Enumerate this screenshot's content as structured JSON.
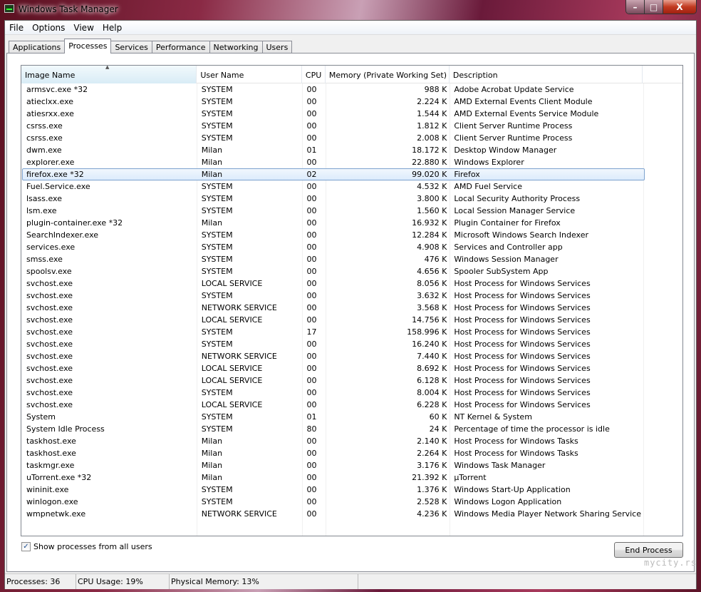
{
  "window": {
    "title": "Windows Task Manager",
    "minimize": "–",
    "maximize": "□",
    "close": "X"
  },
  "menu": [
    "File",
    "Options",
    "View",
    "Help"
  ],
  "tabs": [
    "Applications",
    "Processes",
    "Services",
    "Performance",
    "Networking",
    "Users"
  ],
  "active_tab": "Processes",
  "columns": [
    "Image Name",
    "User Name",
    "CPU",
    "Memory (Private Working Set)",
    "Description"
  ],
  "sort_indicator": "▲",
  "selected_row": 7,
  "processes": [
    [
      "armsvc.exe *32",
      "SYSTEM",
      "00",
      "988 K",
      "Adobe Acrobat Update Service"
    ],
    [
      "atieclxx.exe",
      "SYSTEM",
      "00",
      "2.224 K",
      "AMD External Events Client Module"
    ],
    [
      "atiesrxx.exe",
      "SYSTEM",
      "00",
      "1.544 K",
      "AMD External Events Service Module"
    ],
    [
      "csrss.exe",
      "SYSTEM",
      "00",
      "1.812 K",
      "Client Server Runtime Process"
    ],
    [
      "csrss.exe",
      "SYSTEM",
      "00",
      "2.008 K",
      "Client Server Runtime Process"
    ],
    [
      "dwm.exe",
      "Milan",
      "01",
      "18.172 K",
      "Desktop Window Manager"
    ],
    [
      "explorer.exe",
      "Milan",
      "00",
      "22.880 K",
      "Windows Explorer"
    ],
    [
      "firefox.exe *32",
      "Milan",
      "02",
      "99.020 K",
      "Firefox"
    ],
    [
      "Fuel.Service.exe",
      "SYSTEM",
      "00",
      "4.532 K",
      "AMD Fuel Service"
    ],
    [
      "lsass.exe",
      "SYSTEM",
      "00",
      "3.800 K",
      "Local Security Authority Process"
    ],
    [
      "lsm.exe",
      "SYSTEM",
      "00",
      "1.560 K",
      "Local Session Manager Service"
    ],
    [
      "plugin-container.exe *32",
      "Milan",
      "00",
      "16.932 K",
      "Plugin Container for Firefox"
    ],
    [
      "SearchIndexer.exe",
      "SYSTEM",
      "00",
      "12.284 K",
      "Microsoft Windows Search Indexer"
    ],
    [
      "services.exe",
      "SYSTEM",
      "00",
      "4.908 K",
      "Services and Controller app"
    ],
    [
      "smss.exe",
      "SYSTEM",
      "00",
      "476 K",
      "Windows Session Manager"
    ],
    [
      "spoolsv.exe",
      "SYSTEM",
      "00",
      "4.656 K",
      "Spooler SubSystem App"
    ],
    [
      "svchost.exe",
      "LOCAL SERVICE",
      "00",
      "8.056 K",
      "Host Process for Windows Services"
    ],
    [
      "svchost.exe",
      "SYSTEM",
      "00",
      "3.632 K",
      "Host Process for Windows Services"
    ],
    [
      "svchost.exe",
      "NETWORK SERVICE",
      "00",
      "3.568 K",
      "Host Process for Windows Services"
    ],
    [
      "svchost.exe",
      "LOCAL SERVICE",
      "00",
      "14.756 K",
      "Host Process for Windows Services"
    ],
    [
      "svchost.exe",
      "SYSTEM",
      "17",
      "158.996 K",
      "Host Process for Windows Services"
    ],
    [
      "svchost.exe",
      "SYSTEM",
      "00",
      "16.240 K",
      "Host Process for Windows Services"
    ],
    [
      "svchost.exe",
      "NETWORK SERVICE",
      "00",
      "7.440 K",
      "Host Process for Windows Services"
    ],
    [
      "svchost.exe",
      "LOCAL SERVICE",
      "00",
      "8.692 K",
      "Host Process for Windows Services"
    ],
    [
      "svchost.exe",
      "LOCAL SERVICE",
      "00",
      "6.128 K",
      "Host Process for Windows Services"
    ],
    [
      "svchost.exe",
      "SYSTEM",
      "00",
      "8.004 K",
      "Host Process for Windows Services"
    ],
    [
      "svchost.exe",
      "LOCAL SERVICE",
      "00",
      "6.228 K",
      "Host Process for Windows Services"
    ],
    [
      "System",
      "SYSTEM",
      "01",
      "60 K",
      "NT Kernel & System"
    ],
    [
      "System Idle Process",
      "SYSTEM",
      "80",
      "24 K",
      "Percentage of time the processor is idle"
    ],
    [
      "taskhost.exe",
      "Milan",
      "00",
      "2.140 K",
      "Host Process for Windows Tasks"
    ],
    [
      "taskhost.exe",
      "Milan",
      "00",
      "2.264 K",
      "Host Process for Windows Tasks"
    ],
    [
      "taskmgr.exe",
      "Milan",
      "00",
      "3.176 K",
      "Windows Task Manager"
    ],
    [
      "uTorrent.exe *32",
      "Milan",
      "00",
      "21.392 K",
      "µTorrent"
    ],
    [
      "wininit.exe",
      "SYSTEM",
      "00",
      "1.376 K",
      "Windows Start-Up Application"
    ],
    [
      "winlogon.exe",
      "SYSTEM",
      "00",
      "2.528 K",
      "Windows Logon Application"
    ],
    [
      "wmpnetwk.exe",
      "NETWORK SERVICE",
      "00",
      "4.236 K",
      "Windows Media Player Network Sharing Service"
    ]
  ],
  "show_all": {
    "label": "Show processes from all users",
    "checked": true,
    "mark": "✓"
  },
  "end_process": "End Process",
  "status": {
    "processes": "Processes: 36",
    "cpu": "CPU Usage: 19%",
    "memory": "Physical Memory: 13%"
  },
  "watermark": "mycity.rs"
}
